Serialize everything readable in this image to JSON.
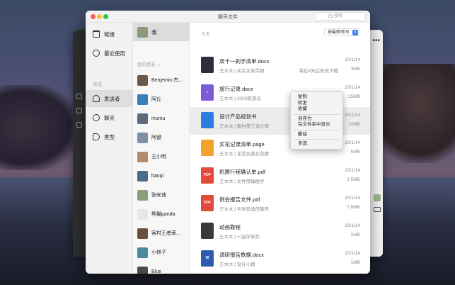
{
  "window": {
    "title": "聊天文件",
    "search_placeholder": "搜索"
  },
  "sidebar": {
    "items": [
      {
        "label": "链接",
        "icon": "folder-icon"
      },
      {
        "label": "最近使用",
        "icon": "clock-icon"
      }
    ],
    "filter_header": "筛选",
    "filters": [
      {
        "label": "发送者",
        "icon": "person-icon",
        "selected": true
      },
      {
        "label": "聊天",
        "icon": "chat-icon"
      },
      {
        "label": "类型",
        "icon": "tag-icon"
      }
    ]
  },
  "contacts": {
    "me_label": "我",
    "friends_header": "我的朋友",
    "list": [
      {
        "name": "Benjemin 杰...",
        "color": "#6b5a4a"
      },
      {
        "name": "阿丘",
        "color": "#3a7fb8"
      },
      {
        "name": "mumu",
        "color": "#5d6b7a"
      },
      {
        "name": "阿键",
        "color": "#7d8fa0"
      },
      {
        "name": "王小明",
        "color": "#b58b6a"
      },
      {
        "name": "hanqi",
        "color": "#4a6b8a"
      },
      {
        "name": "张安迪",
        "color": "#8aa07a"
      },
      {
        "name": "熊猫panda",
        "color": "#e8e8e8"
      },
      {
        "name": "客村王者荣...",
        "color": "#6a5040"
      },
      {
        "name": "小林子",
        "color": "#4d8a9a"
      },
      {
        "name": "Blue",
        "color": "#4a4a4a"
      }
    ]
  },
  "files": {
    "section_label": "今天",
    "sort_label": "按最新时间",
    "items": [
      {
        "name": "双十一剁手清单.docx",
        "sub": "王木木 | 买买买剁手群",
        "note": "将在4天后失效下载",
        "date": "20/1/14",
        "size": "3MB",
        "icon_color": "#2b2f3a",
        "icon_text": ""
      },
      {
        "name": "旅行记录.docx",
        "sub": "王木木 | 2020旅游派",
        "note": "",
        "date": "20/1/14",
        "size": "25MB",
        "icon_color": "#7b5cd6",
        "icon_text": "♫"
      },
      {
        "name": "设计产品规划书",
        "sub": "王木木 | 客村美工设计群",
        "note": "",
        "date": "20/1/14",
        "size": "10MB",
        "icon_color": "#2f7be0",
        "icon_text": ""
      },
      {
        "name": "买花记录清单.page",
        "sub": "王木木 | 花花女孩买花群",
        "note": "",
        "date": "20/1/14",
        "size": "5MB",
        "icon_color": "#f2a22b",
        "icon_text": ""
      },
      {
        "name": "机票行程确认单.pdf",
        "sub": "王木木 | 文件传输助手",
        "note": "",
        "date": "20/1/14",
        "size": "2.5MB",
        "icon_color": "#e24a3b",
        "icon_text": "PDF"
      },
      {
        "name": "例会报告文件.pdf",
        "sub": "王木木 | 与张安迪的聊天",
        "note": "",
        "date": "20/1/14",
        "size": "7.8MB",
        "icon_color": "#e24a3b",
        "icon_text": "PDF"
      },
      {
        "name": "动画教程",
        "sub": "王木木 | 一起学软件",
        "note": "",
        "date": "20/1/14",
        "size": "2MB",
        "icon_color": "#3a3a3a",
        "icon_text": ""
      },
      {
        "name": "调研报告数据.docx",
        "sub": "王木木 | 设计小群",
        "note": "",
        "date": "20/1/14",
        "size": "1MB",
        "icon_color": "#2b5cae",
        "icon_text": "W"
      }
    ]
  },
  "context_menu": {
    "group1": [
      "复制",
      "转发",
      "收藏"
    ],
    "group2": [
      "另存为",
      "在文件夹中显示"
    ],
    "group3": [
      "删除"
    ],
    "group4": [
      "多选"
    ]
  }
}
